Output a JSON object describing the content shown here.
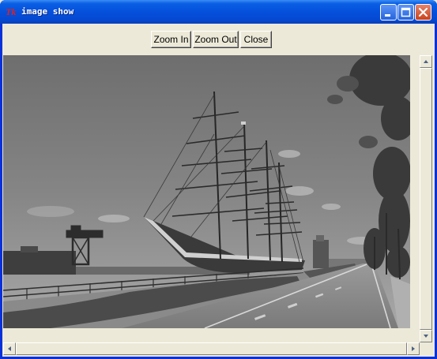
{
  "window": {
    "title": "image show",
    "app_icon": "Tk",
    "controls": [
      "minimize-icon",
      "maximize-icon",
      "close-icon"
    ]
  },
  "toolbar": {
    "zoom_in_label": "Zoom In",
    "zoom_out_label": "Zoom Out",
    "close_label": "Close"
  },
  "image": {
    "subject": "grayscale photo of a tall ship moored at a harbor promenade"
  },
  "scrollbars": {
    "vertical": {
      "position": 0.0,
      "visible_fraction": 0.91
    },
    "horizontal": {
      "position": 0.0,
      "visible_fraction": 0.95
    }
  },
  "colors": {
    "title_bar": "#0550dc",
    "face": "#ece9d8",
    "close_button": "#c9441e"
  }
}
